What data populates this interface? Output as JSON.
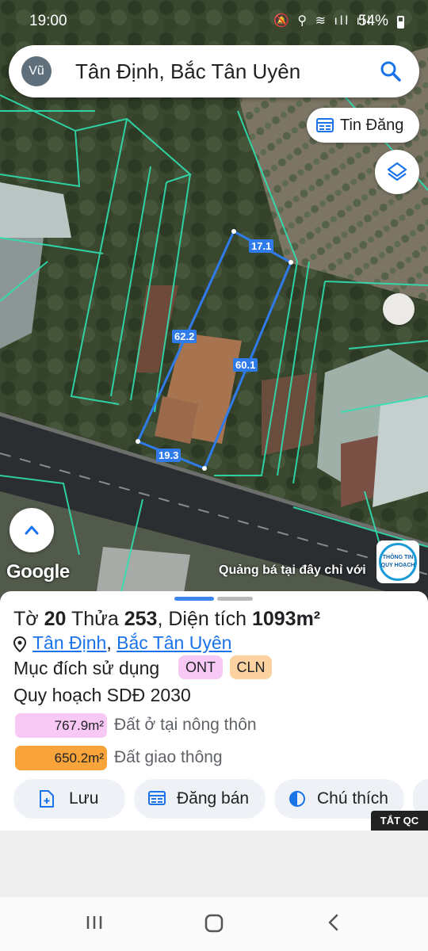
{
  "status_bar": {
    "time": "19:00",
    "battery": "54%",
    "icons": "🔕 ⚲ ≋ ıll ıll"
  },
  "search": {
    "avatar": "Vũ",
    "value": "Tân Định, Bắc Tân Uyên"
  },
  "map": {
    "tin_dang_label": "Tin Đăng",
    "dimensions": {
      "top": "17.1",
      "left": "62.2",
      "right": "60.1",
      "bottom": "19.3"
    },
    "google_label": "Google",
    "ad_text": "Quảng bá tại đây chỉ với",
    "qh_logo_line1": "THÔNG TIN",
    "qh_logo_line2": "QUY HOẠCH"
  },
  "parcel": {
    "sheet_prefix": "Tờ",
    "sheet_no": "20",
    "parcel_prefix": "Thửa",
    "parcel_no": "253",
    "area_prefix": ", Diện tích",
    "area_value": "1093m²",
    "ward": "Tân Định",
    "district": "Bắc Tân Uyên",
    "purpose_label": "Mục đích sử dụng",
    "purpose_tags": [
      "ONT",
      "CLN"
    ],
    "plan_label": "Quy hoạch SDĐ 2030",
    "plan_items": [
      {
        "area": "767.9m²",
        "desc": "Đất ở tại nông thôn",
        "color": "#f8c9f4"
      },
      {
        "area": "650.2m²",
        "desc": "Đất giao thông",
        "color": "#f8a43a"
      }
    ]
  },
  "actions": {
    "save": "Lưu",
    "sell": "Đăng bán",
    "legend": "Chú thích"
  },
  "ads_off": "TẮT QC"
}
